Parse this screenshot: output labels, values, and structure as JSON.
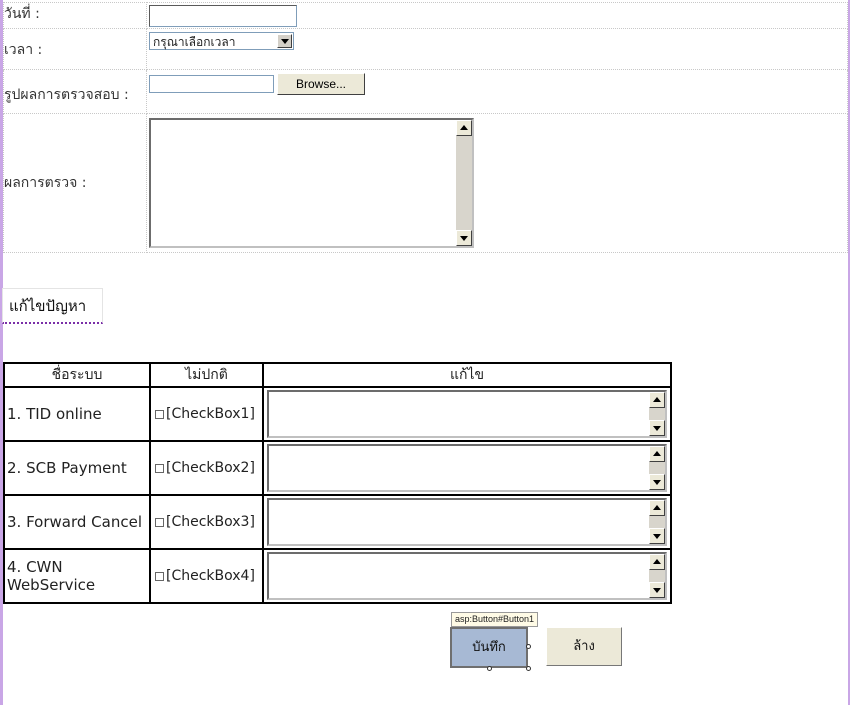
{
  "form": {
    "date_label": "วันที่  :",
    "date_value": "",
    "time_label": "เวลา  :",
    "time_selected": "กรุณาเลือกเวลา",
    "image_label": "รูปผลการตรวจสอบ :",
    "browse_label": "Browse...",
    "result_label": "ผลการตรวจ  :",
    "result_value": ""
  },
  "section": {
    "title": "แก้ไขปัญหา"
  },
  "grid": {
    "headers": [
      "ชื่อระบบ",
      "ไม่ปกติ",
      "แก้ไข"
    ],
    "rows": [
      {
        "name": "1. TID online",
        "checkbox": "[CheckBox1]"
      },
      {
        "name": "2. SCB Payment",
        "checkbox": "[CheckBox2]"
      },
      {
        "name": "3. Forward Cancel",
        "checkbox": "[CheckBox3]"
      },
      {
        "name": "4. CWN WebService",
        "checkbox": "[CheckBox4]"
      }
    ]
  },
  "actions": {
    "designer_tag": "asp:Button#Button1",
    "save_label": "บันทึก",
    "clear_label": "ล้าง"
  },
  "colors": {
    "selected_button": "#a7b9d4",
    "design_border": "#c9a6e6",
    "focus_underline": "#7a2ea8"
  }
}
